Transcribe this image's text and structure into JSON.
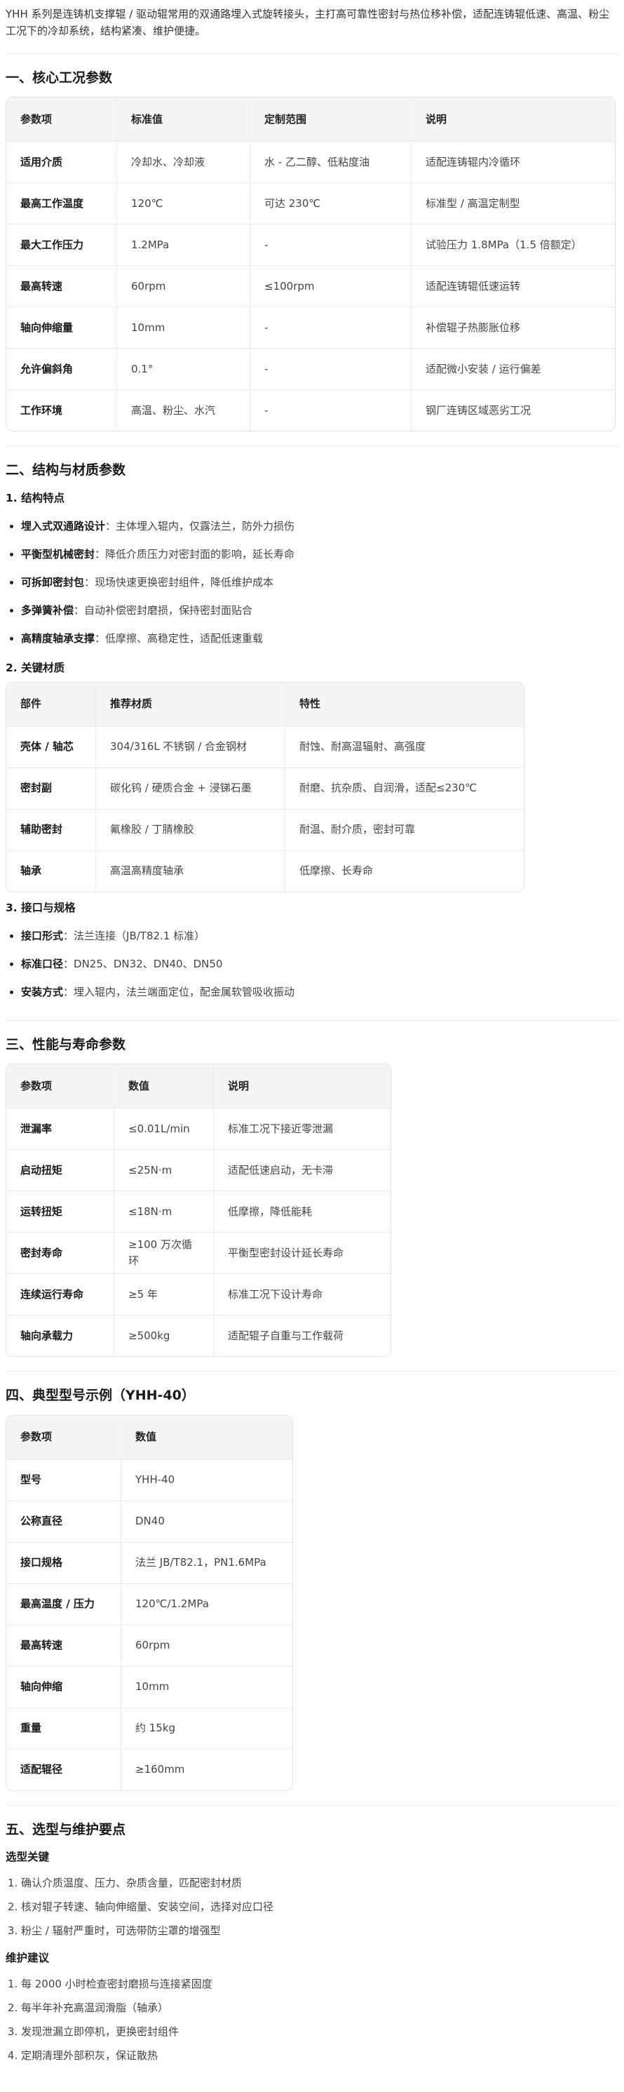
{
  "intro": "YHH 系列是连铸机支撑辊 / 驱动辊常用的双通路埋入式旋转接头，主打高可靠性密封与热位移补偿，适配连铸辊低速、高温、粉尘工况下的冷却系统，结构紧凑、维护便捷。",
  "s1": {
    "title": "一、核心工况参数",
    "headers": [
      "参数项",
      "标准值",
      "定制范围",
      "说明"
    ],
    "rows": [
      [
        "适用介质",
        "冷却水、冷却液",
        "水 - 乙二醇、低粘度油",
        "适配连铸辊内冷循环"
      ],
      [
        "最高工作温度",
        "120℃",
        "可达 230℃",
        "标准型 / 高温定制型"
      ],
      [
        "最大工作压力",
        "1.2MPa",
        "-",
        "试验压力 1.8MPa（1.5 倍额定）"
      ],
      [
        "最高转速",
        "60rpm",
        "≤100rpm",
        "适配连铸辊低速运转"
      ],
      [
        "轴向伸缩量",
        "10mm",
        "-",
        "补偿辊子热膨胀位移"
      ],
      [
        "允许偏斜角",
        "0.1°",
        "-",
        "适配微小安装 / 运行偏差"
      ],
      [
        "工作环境",
        "高温、粉尘、水汽",
        "-",
        "钢厂连铸区域恶劣工况"
      ]
    ]
  },
  "s2": {
    "title": "二、结构与材质参数",
    "sub1": "1. 结构特点",
    "features": [
      {
        "k": "埋入式双通路设计",
        "v": "：主体埋入辊内，仅露法兰，防外力损伤"
      },
      {
        "k": "平衡型机械密封",
        "v": "：降低介质压力对密封面的影响，延长寿命"
      },
      {
        "k": "可拆卸密封包",
        "v": "：现场快速更换密封组件，降低维护成本"
      },
      {
        "k": "多弹簧补偿",
        "v": "：自动补偿密封磨损，保持密封面贴合"
      },
      {
        "k": "高精度轴承支撑",
        "v": "：低摩擦、高稳定性，适配低速重载"
      }
    ],
    "sub2": "2. 关键材质",
    "mat_headers": [
      "部件",
      "推荐材质",
      "特性"
    ],
    "mat_rows": [
      [
        "壳体 / 轴芯",
        "304/316L 不锈钢 / 合金钢材",
        "耐蚀、耐高温辐射、高强度"
      ],
      [
        "密封副",
        "碳化钨 / 硬质合金 + 浸锑石墨",
        "耐磨、抗杂质、自润滑，适配≤230℃"
      ],
      [
        "辅助密封",
        "氟橡胶 / 丁腈橡胶",
        "耐温、耐介质，密封可靠"
      ],
      [
        "轴承",
        "高温高精度轴承",
        "低摩擦、长寿命"
      ]
    ],
    "sub3": "3. 接口与规格",
    "specs": [
      {
        "k": "接口形式",
        "v": "：法兰连接（JB/T82.1 标准）"
      },
      {
        "k": "标准口径",
        "v": "：DN25、DN32、DN40、DN50"
      },
      {
        "k": "安装方式",
        "v": "：埋入辊内，法兰端面定位，配金属软管吸收振动"
      }
    ]
  },
  "s3": {
    "title": "三、性能与寿命参数",
    "headers": [
      "参数项",
      "数值",
      "说明"
    ],
    "rows": [
      [
        "泄漏率",
        "≤0.01L/min",
        "标准工况下接近零泄漏"
      ],
      [
        "启动扭矩",
        "≤25N·m",
        "适配低速启动，无卡滞"
      ],
      [
        "运转扭矩",
        "≤18N·m",
        "低摩擦，降低能耗"
      ],
      [
        "密封寿命",
        "≥100 万次循环",
        "平衡型密封设计延长寿命"
      ],
      [
        "连续运行寿命",
        "≥5 年",
        "标准工况下设计寿命"
      ],
      [
        "轴向承载力",
        "≥500kg",
        "适配辊子自重与工作载荷"
      ]
    ]
  },
  "s4": {
    "title": "四、典型型号示例（YHH-40）",
    "headers": [
      "参数项",
      "数值"
    ],
    "rows": [
      [
        "型号",
        "YHH-40"
      ],
      [
        "公称直径",
        "DN40"
      ],
      [
        "接口规格",
        "法兰 JB/T82.1，PN1.6MPa"
      ],
      [
        "最高温度 / 压力",
        "120℃/1.2MPa"
      ],
      [
        "最高转速",
        "60rpm"
      ],
      [
        "轴向伸缩",
        "10mm"
      ],
      [
        "重量",
        "约 15kg"
      ],
      [
        "适配辊径",
        "≥160mm"
      ]
    ]
  },
  "s5": {
    "title": "五、选型与维护要点",
    "sub1": "选型关键",
    "select": [
      "确认介质温度、压力、杂质含量，匹配密封材质",
      "核对辊子转速、轴向伸缩量、安装空间，选择对应口径",
      "粉尘 / 辐射严重时，可选带防尘罩的增强型"
    ],
    "sub2": "维护建议",
    "maint": [
      "每 2000 小时检查密封磨损与连接紧固度",
      "每半年补充高温润滑脂（轴承）",
      "发现泄漏立即停机，更换密封组件",
      "定期清理外部积灰，保证散热"
    ]
  }
}
